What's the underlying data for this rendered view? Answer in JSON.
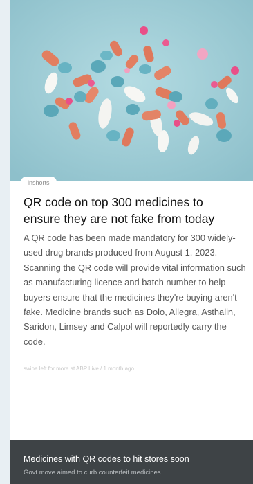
{
  "article": {
    "source_tag": "inshorts",
    "headline": "QR code on top 300 medicines to ensure they are not fake from today",
    "summary": "A QR code has been made mandatory for 300 widely-used drug brands produced from August 1, 2023. Scanning the QR code will provide vital information such as manufacturing licence and batch number to help buyers ensure that the medicines they're buying aren't fake. Medicine brands such as Dolo, Allegra, Asthalin, Saridon, Limsey and Calpol will reportedly carry the code.",
    "footnote": "swipe left for more at ABP Live / 1 month ago"
  },
  "bottom_bar": {
    "title": "Medicines with QR codes to hit stores soon",
    "subtitle": "Govt move aimed to curb counterfeit medicines"
  },
  "colors": {
    "hero_background": "#9cc9d3",
    "bottom_bar": "#3e4346"
  }
}
